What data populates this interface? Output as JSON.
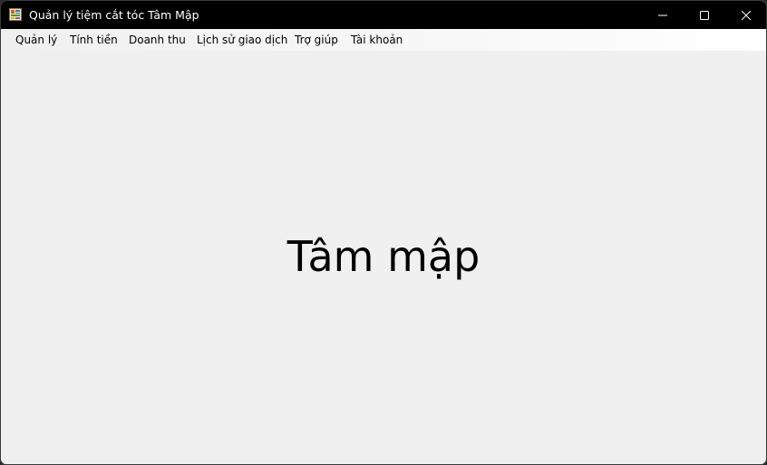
{
  "window": {
    "title": "Quản lý tiệm cắt tóc Tâm Mập",
    "app_icon": "form-app-icon",
    "controls": {
      "minimize_icon": "minimize-icon",
      "maximize_icon": "maximize-icon",
      "close_icon": "close-icon"
    }
  },
  "menu": {
    "items": [
      "Quản lý",
      "Tính tiền",
      "Doanh thu",
      "Lịch sử giao dịch",
      "Trợ giúp",
      "Tài khoản"
    ]
  },
  "main": {
    "label": "Tâm mập"
  },
  "colors": {
    "titlebar": "#000000",
    "background": "#f0f0f0",
    "text": "#000000"
  }
}
